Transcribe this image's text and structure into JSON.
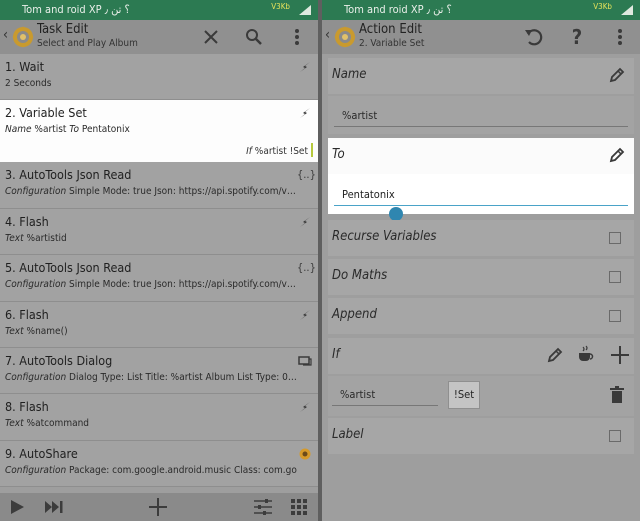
{
  "status": {
    "text": "Tom and roid XP ؟ تن ٫",
    "download": "V3Kb"
  },
  "left": {
    "title": "Task Edit",
    "subtitle": "Select and Play Album",
    "actions": [
      {
        "head": "1.  Wait",
        "detail_key": "",
        "detail_val": "2 Seconds",
        "icon": "lightning-icon"
      },
      {
        "head": "2.  Variable Set",
        "detail_key": "Name",
        "detail_val": "%artist",
        "detail_key2": "To",
        "detail_val2": "Pentatonix",
        "icon": "lightning-icon",
        "cond_key": "If",
        "cond_val": "%artist !Set"
      },
      {
        "head": "3.  AutoTools Json Read",
        "detail_key": "Configuration",
        "detail_val": "Simple Mode: true Json: https://api.spotify.com/v…",
        "icon": "braces-icon"
      },
      {
        "head": "4.  Flash",
        "detail_key": "Text",
        "detail_val": "%artistid",
        "icon": "lightning-icon"
      },
      {
        "head": "5.  AutoTools Json Read",
        "detail_key": "Configuration",
        "detail_val": "Simple Mode: true Json: https://api.spotify.com/v…",
        "icon": "braces-icon"
      },
      {
        "head": "6.  Flash",
        "detail_key": "Text",
        "detail_val": "%name()",
        "icon": "lightning-icon"
      },
      {
        "head": "7.  AutoTools Dialog",
        "detail_key": "Configuration",
        "detail_val": "Dialog Type: List Title: %artist Album List Type: 0…",
        "icon": "dialog-icon"
      },
      {
        "head": "8.  Flash",
        "detail_key": "Text",
        "detail_val": "%atcommand",
        "icon": "lightning-icon"
      },
      {
        "head": "9.  AutoShare",
        "detail_key": "Configuration",
        "detail_val": "Package: com.google.android.music Class: com.go…",
        "icon": "share-plugin-icon"
      }
    ]
  },
  "right": {
    "title": "Action Edit",
    "subtitle": "2. Variable Set",
    "name_label": "Name",
    "name_value": "%artist",
    "to_label": "To",
    "to_value": "Pentatonix",
    "recurse_label": "Recurse Variables",
    "maths_label": "Do Maths",
    "append_label": "Append",
    "if_label": "If",
    "if_var": "%artist",
    "if_op": "!Set",
    "label_label": "Label"
  }
}
